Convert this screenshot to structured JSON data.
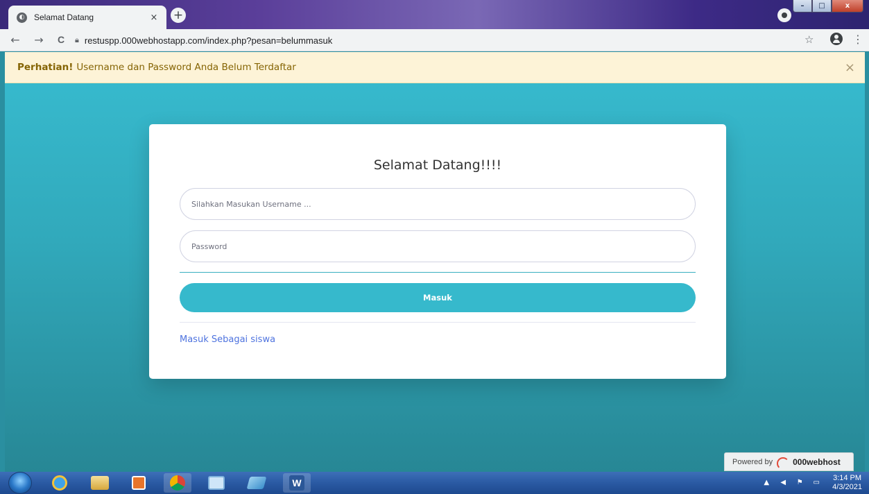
{
  "browser": {
    "tab_title": "Selamat Datang",
    "tab_close": "×",
    "new_tab": "+",
    "url": "restuspp.000webhostapp.com/index.php?pesan=belummasuk",
    "back": "←",
    "forward": "→",
    "reload": "C",
    "star": "☆",
    "menu": "⋮",
    "win_min": "–",
    "win_max": "□",
    "win_close": "x"
  },
  "alert": {
    "strong": "Perhatian!",
    "message": "Username dan Password Anda Belum Terdaftar",
    "close": "×"
  },
  "login": {
    "title": "Selamat Datang!!!!",
    "username_placeholder": "Silahkan Masukan Username ...",
    "username_value": "",
    "password_placeholder": "Password",
    "password_value": "",
    "submit_label": "Masuk",
    "student_link": "Masuk Sebagai siswa"
  },
  "powered": {
    "prefix": "Powered by",
    "brand": "000webhost"
  },
  "taskbar": {
    "time": "3:14 PM",
    "date": "4/3/2021",
    "apps": [
      "start-orb",
      "internet-explorer-icon",
      "file-explorer-icon",
      "media-player-icon",
      "chrome-icon",
      "control-panel-icon",
      "notepad-icon",
      "word-icon"
    ]
  },
  "colors": {
    "accent": "#36b9cc",
    "link": "#4e73df",
    "alert_bg": "#fdf3d7",
    "alert_text": "#856404"
  }
}
